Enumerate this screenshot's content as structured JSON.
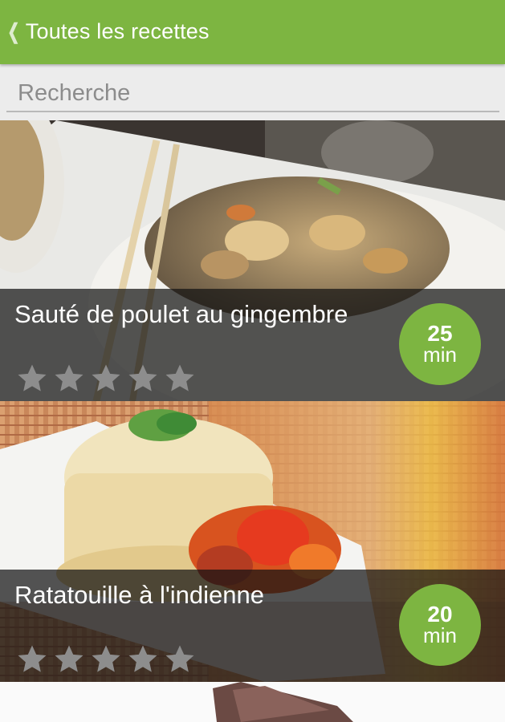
{
  "header": {
    "back_icon": "chevron-left-icon",
    "title": "Toutes les recettes",
    "accent_color": "#7db541"
  },
  "search": {
    "placeholder": "Recherche",
    "value": ""
  },
  "recipes": [
    {
      "title": "Sauté de poulet au gingembre",
      "rating": 0,
      "max_rating": 5,
      "time_value": "25",
      "time_unit": "min"
    },
    {
      "title": "Ratatouille à l'indienne",
      "rating": 0,
      "max_rating": 5,
      "time_value": "20",
      "time_unit": "min"
    }
  ]
}
